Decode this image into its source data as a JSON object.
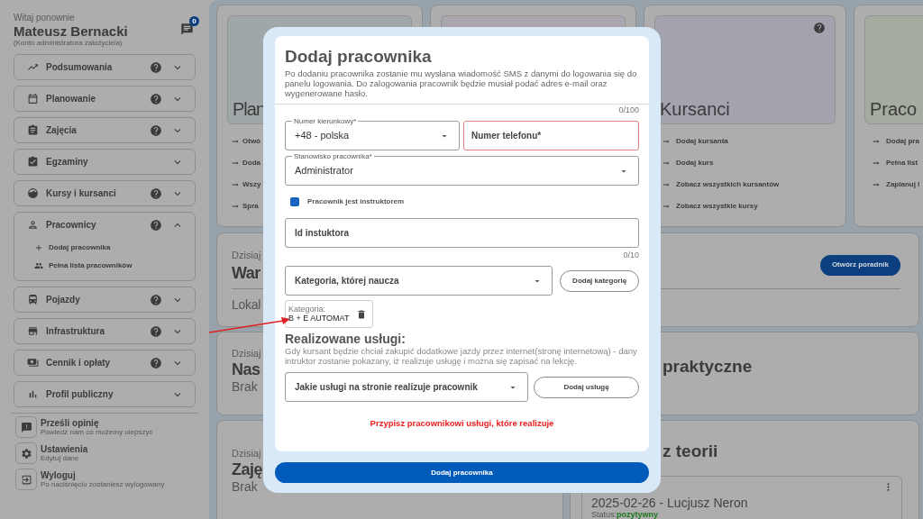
{
  "sidebar": {
    "greeting": "Witaj ponownie",
    "user_name": "Mateusz Bernacki",
    "account_note": "(Konto administratora założyciela)",
    "messages_badge": "0",
    "nav": [
      {
        "label": "Podsumowania",
        "help": true,
        "expanded": false
      },
      {
        "label": "Planowanie",
        "help": true,
        "expanded": false
      },
      {
        "label": "Zajęcia",
        "help": true,
        "expanded": false
      },
      {
        "label": "Egzaminy",
        "help": false,
        "expanded": false
      },
      {
        "label": "Kursy i kursanci",
        "help": true,
        "expanded": false
      },
      {
        "label": "Pracownicy",
        "help": true,
        "expanded": true,
        "children": [
          {
            "label": "Dodaj pracownika"
          },
          {
            "label": "Pełna lista pracowników"
          }
        ]
      },
      {
        "label": "Pojazdy",
        "help": true,
        "expanded": false
      },
      {
        "label": "Infrastruktura",
        "help": true,
        "expanded": false
      },
      {
        "label": "Cennik i opłaty",
        "help": true,
        "expanded": false
      },
      {
        "label": "Profil publiczny",
        "help": false,
        "expanded": false
      }
    ],
    "footer": [
      {
        "title": "Prześli opinię",
        "subtitle": "Powiedź nam co możemy ulepszyć"
      },
      {
        "title": "Ustawienia",
        "subtitle": "Edytuj dane"
      },
      {
        "title": "Wyloguj",
        "subtitle": "Po naciśnięciu zostaniesz wylogowany"
      }
    ]
  },
  "dashboard": {
    "shortcut_cards": [
      {
        "title": "Plan",
        "links": [
          "Otwó",
          "Doda",
          "Wszy",
          "Spra"
        ]
      },
      {
        "title": "Kursanci",
        "help": true,
        "links": [
          "Dodaj kursanta",
          "Dodaj kurs",
          "Zobacz wszystkich kursantów",
          "Zobacz wszystkie kursy"
        ]
      },
      {
        "title": "Praco",
        "links": [
          "Dodaj pra",
          "Pełna list",
          "Zaplanuj l"
        ]
      }
    ],
    "guide_panel": {
      "label": "Dzisiaj",
      "title": "War",
      "detail": "Lokal",
      "button": "Otwórz poradnik"
    },
    "today_rows": [
      {
        "label": "Dzisiaj",
        "title": "Nas",
        "detail": "Brak",
        "right_title": "praktyczne"
      },
      {
        "label": "Dzisiaj",
        "title": "Zaję",
        "detail": "Brak",
        "right_title": "z teorii",
        "entry": {
          "date": "2025-02-26",
          "person": "- Lucjusz Neron",
          "status_label": "Status:",
          "status": "pozytywny"
        }
      }
    ]
  },
  "modal": {
    "title": "Dodaj pracownika",
    "description": "Po dodaniu pracownika zostanie mu wysłana wiadomość SMS z danymi do logowania się do panelu logowania. Do zalogowania pracownik będzie musiał podać adres e-mail oraz wygenerowane hasło.",
    "counter": "0/100",
    "dial_code": {
      "label": "Numer kierunkowy*",
      "value": "+48 - polska"
    },
    "phone": {
      "placeholder": "Numer telefonu*",
      "invalid": true
    },
    "position": {
      "label": "Stanowisko pracownika*",
      "value": "Administrator"
    },
    "instructor_checkbox": {
      "label": "Pracownik jest instruktorem",
      "checked": true
    },
    "instructor_id": {
      "placeholder": "Id instuktora",
      "counter": "0/10"
    },
    "category_select": {
      "placeholder": "Kategoria, której naucza"
    },
    "add_category_button": "Dodaj kategorię",
    "categories": [
      {
        "label": "Kategoria:",
        "value": "B + E AUTOMAT"
      }
    ],
    "services_heading": "Realizowane usługi:",
    "services_description": "Gdy kursant będzie chciał zakupić dodatkowe jazdy przez internet(stronę internetową) - dany intruktor zostanie pokazany, iż realizuje usługę i można się zapisać na lekcję.",
    "service_select": {
      "placeholder": "Jakie usługi na stronie realizuje pracownik"
    },
    "add_service_button": "Dodaj usługę",
    "error_message": "Przypisz pracownikowi usługi, które realizuje",
    "submit_button": "Dodaj pracownika"
  }
}
